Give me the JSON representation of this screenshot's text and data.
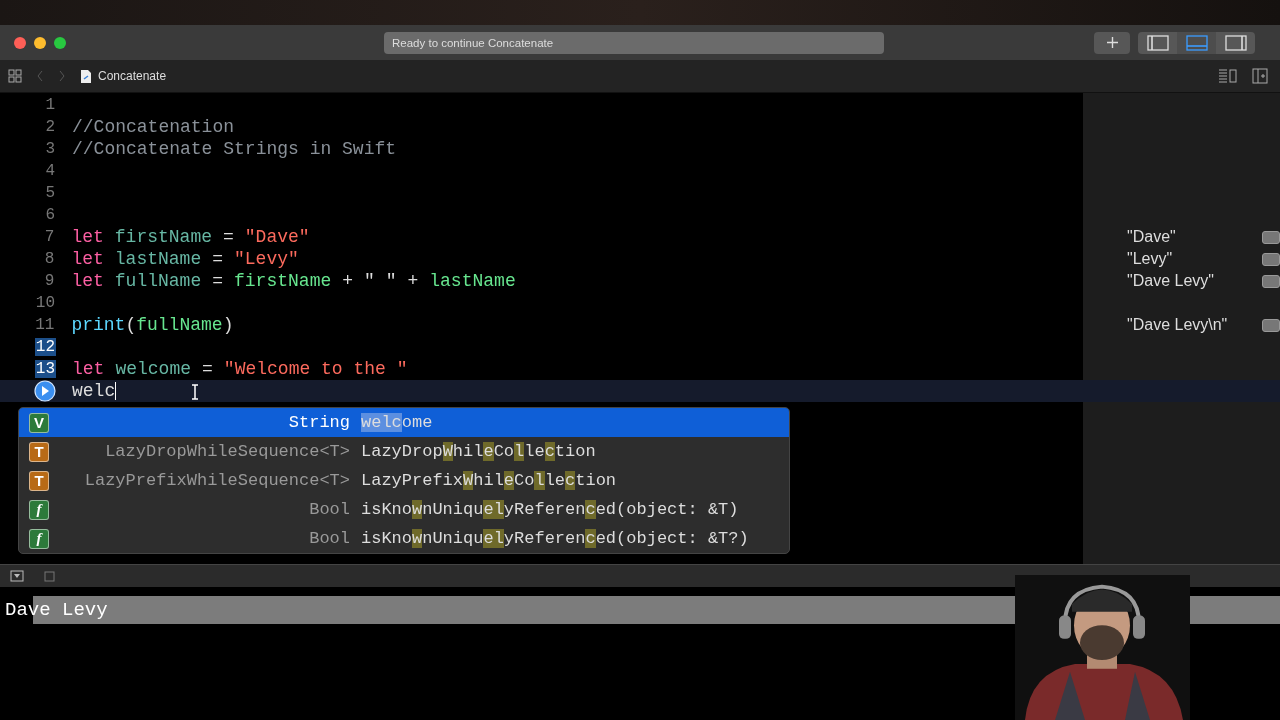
{
  "window": {
    "status": "Ready to continue Concatenate",
    "panel_toggles": [
      {
        "kind": "left",
        "selected": false
      },
      {
        "kind": "bottom",
        "selected": true
      },
      {
        "kind": "right",
        "selected": false
      }
    ]
  },
  "toolbar": {
    "file": "Concatenate"
  },
  "editor": {
    "lines": [
      {
        "number": "1",
        "kind": "numbered",
        "selected": false,
        "current": false
      },
      {
        "number": "2",
        "kind": "numbered",
        "selected": false,
        "current": false,
        "tokens": [
          {
            "kind": "comment",
            "text": "//Concatenation"
          }
        ]
      },
      {
        "number": "3",
        "kind": "numbered",
        "selected": false,
        "current": false,
        "tokens": [
          {
            "kind": "comment",
            "text": "//Concatenate Strings in Swift"
          }
        ]
      },
      {
        "number": "4",
        "kind": "numbered",
        "selected": false,
        "current": false
      },
      {
        "number": "5",
        "kind": "numbered",
        "selected": false,
        "current": false
      },
      {
        "number": "6",
        "kind": "numbered",
        "selected": false,
        "current": false
      },
      {
        "number": "7",
        "kind": "numbered",
        "selected": false,
        "current": false,
        "result": "\"Dave\"",
        "tokens": [
          {
            "kind": "keyword",
            "text": "let"
          },
          {
            "kind": "decl",
            "text": "firstName"
          },
          {
            "kind": "plain",
            "text": "="
          },
          {
            "kind": "string",
            "text": "\"Dave\""
          }
        ]
      },
      {
        "number": "8",
        "kind": "numbered",
        "selected": false,
        "current": false,
        "result": "\"Levy\"",
        "tokens": [
          {
            "kind": "keyword",
            "text": "let"
          },
          {
            "kind": "decl",
            "text": "lastName"
          },
          {
            "kind": "plain",
            "text": "="
          },
          {
            "kind": "string",
            "text": "\"Levy\""
          }
        ]
      },
      {
        "number": "9",
        "kind": "numbered",
        "selected": false,
        "current": false,
        "result": "\"Dave Levy\"",
        "tokens": [
          {
            "kind": "keyword",
            "text": "let"
          },
          {
            "kind": "decl",
            "text": "fullName"
          },
          {
            "kind": "plain",
            "text": "="
          },
          {
            "kind": "ref",
            "text": "firstName"
          },
          {
            "kind": "plain",
            "text": "+"
          },
          {
            "kind": "plain",
            "text": "\" \""
          },
          {
            "kind": "plain",
            "text": "+"
          },
          {
            "kind": "ref",
            "text": "lastName"
          }
        ]
      },
      {
        "number": "10",
        "kind": "numbered",
        "selected": false,
        "current": false
      },
      {
        "number": "11",
        "kind": "numbered",
        "selected": false,
        "current": false,
        "result": "\"Dave Levy\\n\"",
        "tokens": [
          {
            "kind": "func",
            "text": "print"
          },
          {
            "kind": "paren",
            "text": "("
          },
          {
            "kind": "ref",
            "text": "fullName"
          },
          {
            "kind": "paren",
            "text": ")"
          }
        ]
      },
      {
        "number": "12",
        "kind": "numbered",
        "selected": true,
        "current": false
      },
      {
        "number": "13",
        "kind": "numbered",
        "selected": true,
        "current": false,
        "tokens": [
          {
            "kind": "keyword",
            "text": "let"
          },
          {
            "kind": "decl",
            "text": "welcome"
          },
          {
            "kind": "plain",
            "text": "="
          },
          {
            "kind": "string",
            "text": "\"Welcome to the \""
          }
        ]
      },
      {
        "kind": "run",
        "current": true,
        "tokens": [
          {
            "kind": "typed",
            "text": "welc"
          }
        ]
      }
    ]
  },
  "completions": [
    {
      "kind": "variable",
      "badge": "V",
      "type": "String",
      "selected": true,
      "name": [
        {
          "text": "welc",
          "match": true
        },
        {
          "text": "ome",
          "match": false
        }
      ]
    },
    {
      "kind": "type",
      "badge": "T",
      "type": "LazyDropWhileSequence<T>",
      "selected": false,
      "name": [
        {
          "text": "LazyDrop",
          "match": false
        },
        {
          "text": "W",
          "match": true
        },
        {
          "text": "hil",
          "match": false
        },
        {
          "text": "e",
          "match": true
        },
        {
          "text": "Co",
          "match": false
        },
        {
          "text": "l",
          "match": true
        },
        {
          "text": "le",
          "match": false
        },
        {
          "text": "c",
          "match": true
        },
        {
          "text": "tion",
          "match": false
        }
      ]
    },
    {
      "kind": "type",
      "badge": "T",
      "type": "LazyPrefixWhileSequence<T>",
      "selected": false,
      "name": [
        {
          "text": "LazyPrefix",
          "match": false
        },
        {
          "text": "W",
          "match": true
        },
        {
          "text": "hil",
          "match": false
        },
        {
          "text": "e",
          "match": true
        },
        {
          "text": "Co",
          "match": false
        },
        {
          "text": "l",
          "match": true
        },
        {
          "text": "le",
          "match": false
        },
        {
          "text": "c",
          "match": true
        },
        {
          "text": "tion",
          "match": false
        }
      ]
    },
    {
      "kind": "function",
      "badge": "f",
      "type": "Bool",
      "selected": false,
      "name": [
        {
          "text": "isKno",
          "match": false
        },
        {
          "text": "w",
          "match": true
        },
        {
          "text": "nUniqu",
          "match": false
        },
        {
          "text": "el",
          "match": true
        },
        {
          "text": "yReferen",
          "match": false
        },
        {
          "text": "c",
          "match": true
        },
        {
          "text": "ed(object: &T)",
          "match": false
        }
      ]
    },
    {
      "kind": "function",
      "badge": "f",
      "type": "Bool",
      "selected": false,
      "name": [
        {
          "text": "isKno",
          "match": false
        },
        {
          "text": "w",
          "match": true
        },
        {
          "text": "nUniqu",
          "match": false
        },
        {
          "text": "el",
          "match": true
        },
        {
          "text": "yReferen",
          "match": false
        },
        {
          "text": "c",
          "match": true
        },
        {
          "text": "ed(object: &T?)",
          "match": false
        }
      ]
    }
  ],
  "console": {
    "output": "Dave Levy"
  }
}
